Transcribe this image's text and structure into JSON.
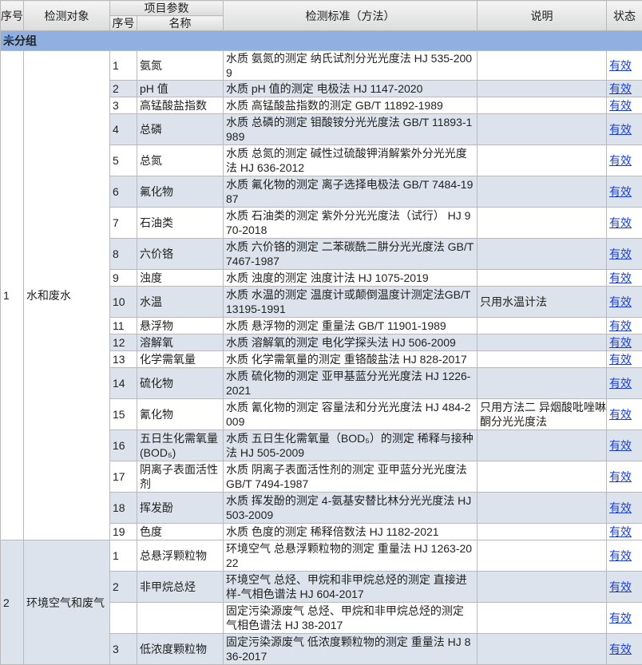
{
  "header": {
    "seq": "序号",
    "object": "检测对象",
    "param_group": "项目参数",
    "param_seq": "序号",
    "param_name": "名称",
    "standard": "检测标准（方法）",
    "note": "说明",
    "status": "状态"
  },
  "group": {
    "label": "未分组"
  },
  "objects": [
    {
      "seq": "1",
      "name": "水和废水",
      "rows": [
        {
          "seq": "1",
          "name": "氨氮",
          "standard": "水质 氨氮的测定 纳氏试剂分光光度法 HJ 535-2009",
          "note": "",
          "status": "有效"
        },
        {
          "seq": "2",
          "name": "pH 值",
          "standard": "水质 pH 值的测定 电极法 HJ 1147-2020",
          "note": "",
          "status": "有效"
        },
        {
          "seq": "3",
          "name": "高锰酸盐指数",
          "standard": "水质 高锰酸盐指数的测定 GB/T 11892-1989",
          "note": "",
          "status": "有效"
        },
        {
          "seq": "4",
          "name": "总磷",
          "standard": "水质 总磷的测定 钼酸铵分光光度法 GB/T 11893-1989",
          "note": "",
          "status": "有效"
        },
        {
          "seq": "5",
          "name": "总氮",
          "standard": "水质 总氮的测定 碱性过硫酸钾消解紫外分光光度法 HJ 636-2012",
          "note": "",
          "status": "有效"
        },
        {
          "seq": "6",
          "name": "氟化物",
          "standard": "水质 氟化物的测定 离子选择电极法 GB/T 7484-1987",
          "note": "",
          "status": "有效"
        },
        {
          "seq": "7",
          "name": "石油类",
          "standard": "水质 石油类的测定 紫外分光光度法（试行） HJ 970-2018",
          "note": "",
          "status": "有效"
        },
        {
          "seq": "8",
          "name": "六价铬",
          "standard": "水质 六价铬的测定 二苯碳酰二肼分光光度法 GB/T 7467-1987",
          "note": "",
          "status": "有效"
        },
        {
          "seq": "9",
          "name": "浊度",
          "standard": "水质 浊度的测定 浊度计法 HJ 1075-2019",
          "note": "",
          "status": "有效"
        },
        {
          "seq": "10",
          "name": "水温",
          "standard": "水质 水温的测定 温度计或颠倒温度计测定法GB/T 13195-1991",
          "note": "只用水温计法",
          "status": "有效"
        },
        {
          "seq": "11",
          "name": "悬浮物",
          "standard": "水质 悬浮物的测定 重量法 GB/T 11901-1989",
          "note": "",
          "status": "有效"
        },
        {
          "seq": "12",
          "name": "溶解氧",
          "standard": "水质 溶解氧的测定 电化学探头法 HJ 506-2009",
          "note": "",
          "status": "有效"
        },
        {
          "seq": "13",
          "name": "化学需氧量",
          "standard": "水质 化学需氧量的测定 重铬酸盐法 HJ 828-2017",
          "note": "",
          "status": "有效"
        },
        {
          "seq": "14",
          "name": "硫化物",
          "standard": "水质 硫化物的测定 亚甲基蓝分光光度法 HJ 1226-2021",
          "note": "",
          "status": "有效"
        },
        {
          "seq": "15",
          "name": "氰化物",
          "standard": "水质 氰化物的测定 容量法和分光光度法 HJ 484-2009",
          "note": "只用方法二 异烟酸吡唑啉酮分光光度法",
          "status": "有效"
        },
        {
          "seq": "16",
          "name": "五日生化需氧量(BOD₅)",
          "standard": "水质 五日生化需氧量（BOD₅）的测定 稀释与接种法 HJ 505-2009",
          "note": "",
          "status": "有效"
        },
        {
          "seq": "17",
          "name": "阴离子表面活性剂",
          "standard": "水质 阴离子表面活性剂的测定 亚甲蓝分光光度法 GB/T 7494-1987",
          "note": "",
          "status": "有效"
        },
        {
          "seq": "18",
          "name": "挥发酚",
          "standard": "水质 挥发酚的测定 4-氨基安替比林分光光度法 HJ 503-2009",
          "note": "",
          "status": "有效"
        },
        {
          "seq": "19",
          "name": "色度",
          "standard": "水质 色度的测定 稀释倍数法 HJ 1182-2021",
          "note": "",
          "status": "有效"
        }
      ]
    },
    {
      "seq": "2",
      "name": "环境空气和废气",
      "rows": [
        {
          "seq": "1",
          "name": "总悬浮颗粒物",
          "standard": "环境空气 总悬浮颗粒物的测定 重量法 HJ 1263-2022",
          "note": "",
          "status": "有效"
        },
        {
          "seq": "2",
          "name": "非甲烷总烃",
          "standard": "环境空气 总烃、甲烷和非甲烷总烃的测定 直接进样-气相色谱法 HJ 604-2017",
          "note": "",
          "status": "有效"
        },
        {
          "seq": "",
          "name": "",
          "standard": "固定污染源废气 总烃、甲烷和非甲烷总烃的测定 气相色谱法 HJ 38-2017",
          "note": "",
          "status": "有效"
        },
        {
          "seq": "3",
          "name": "低浓度颗粒物",
          "standard": "固定污染源废气 低浓度颗粒物的测定 重量法 HJ 836-2017",
          "note": "",
          "status": "有效"
        }
      ]
    }
  ]
}
